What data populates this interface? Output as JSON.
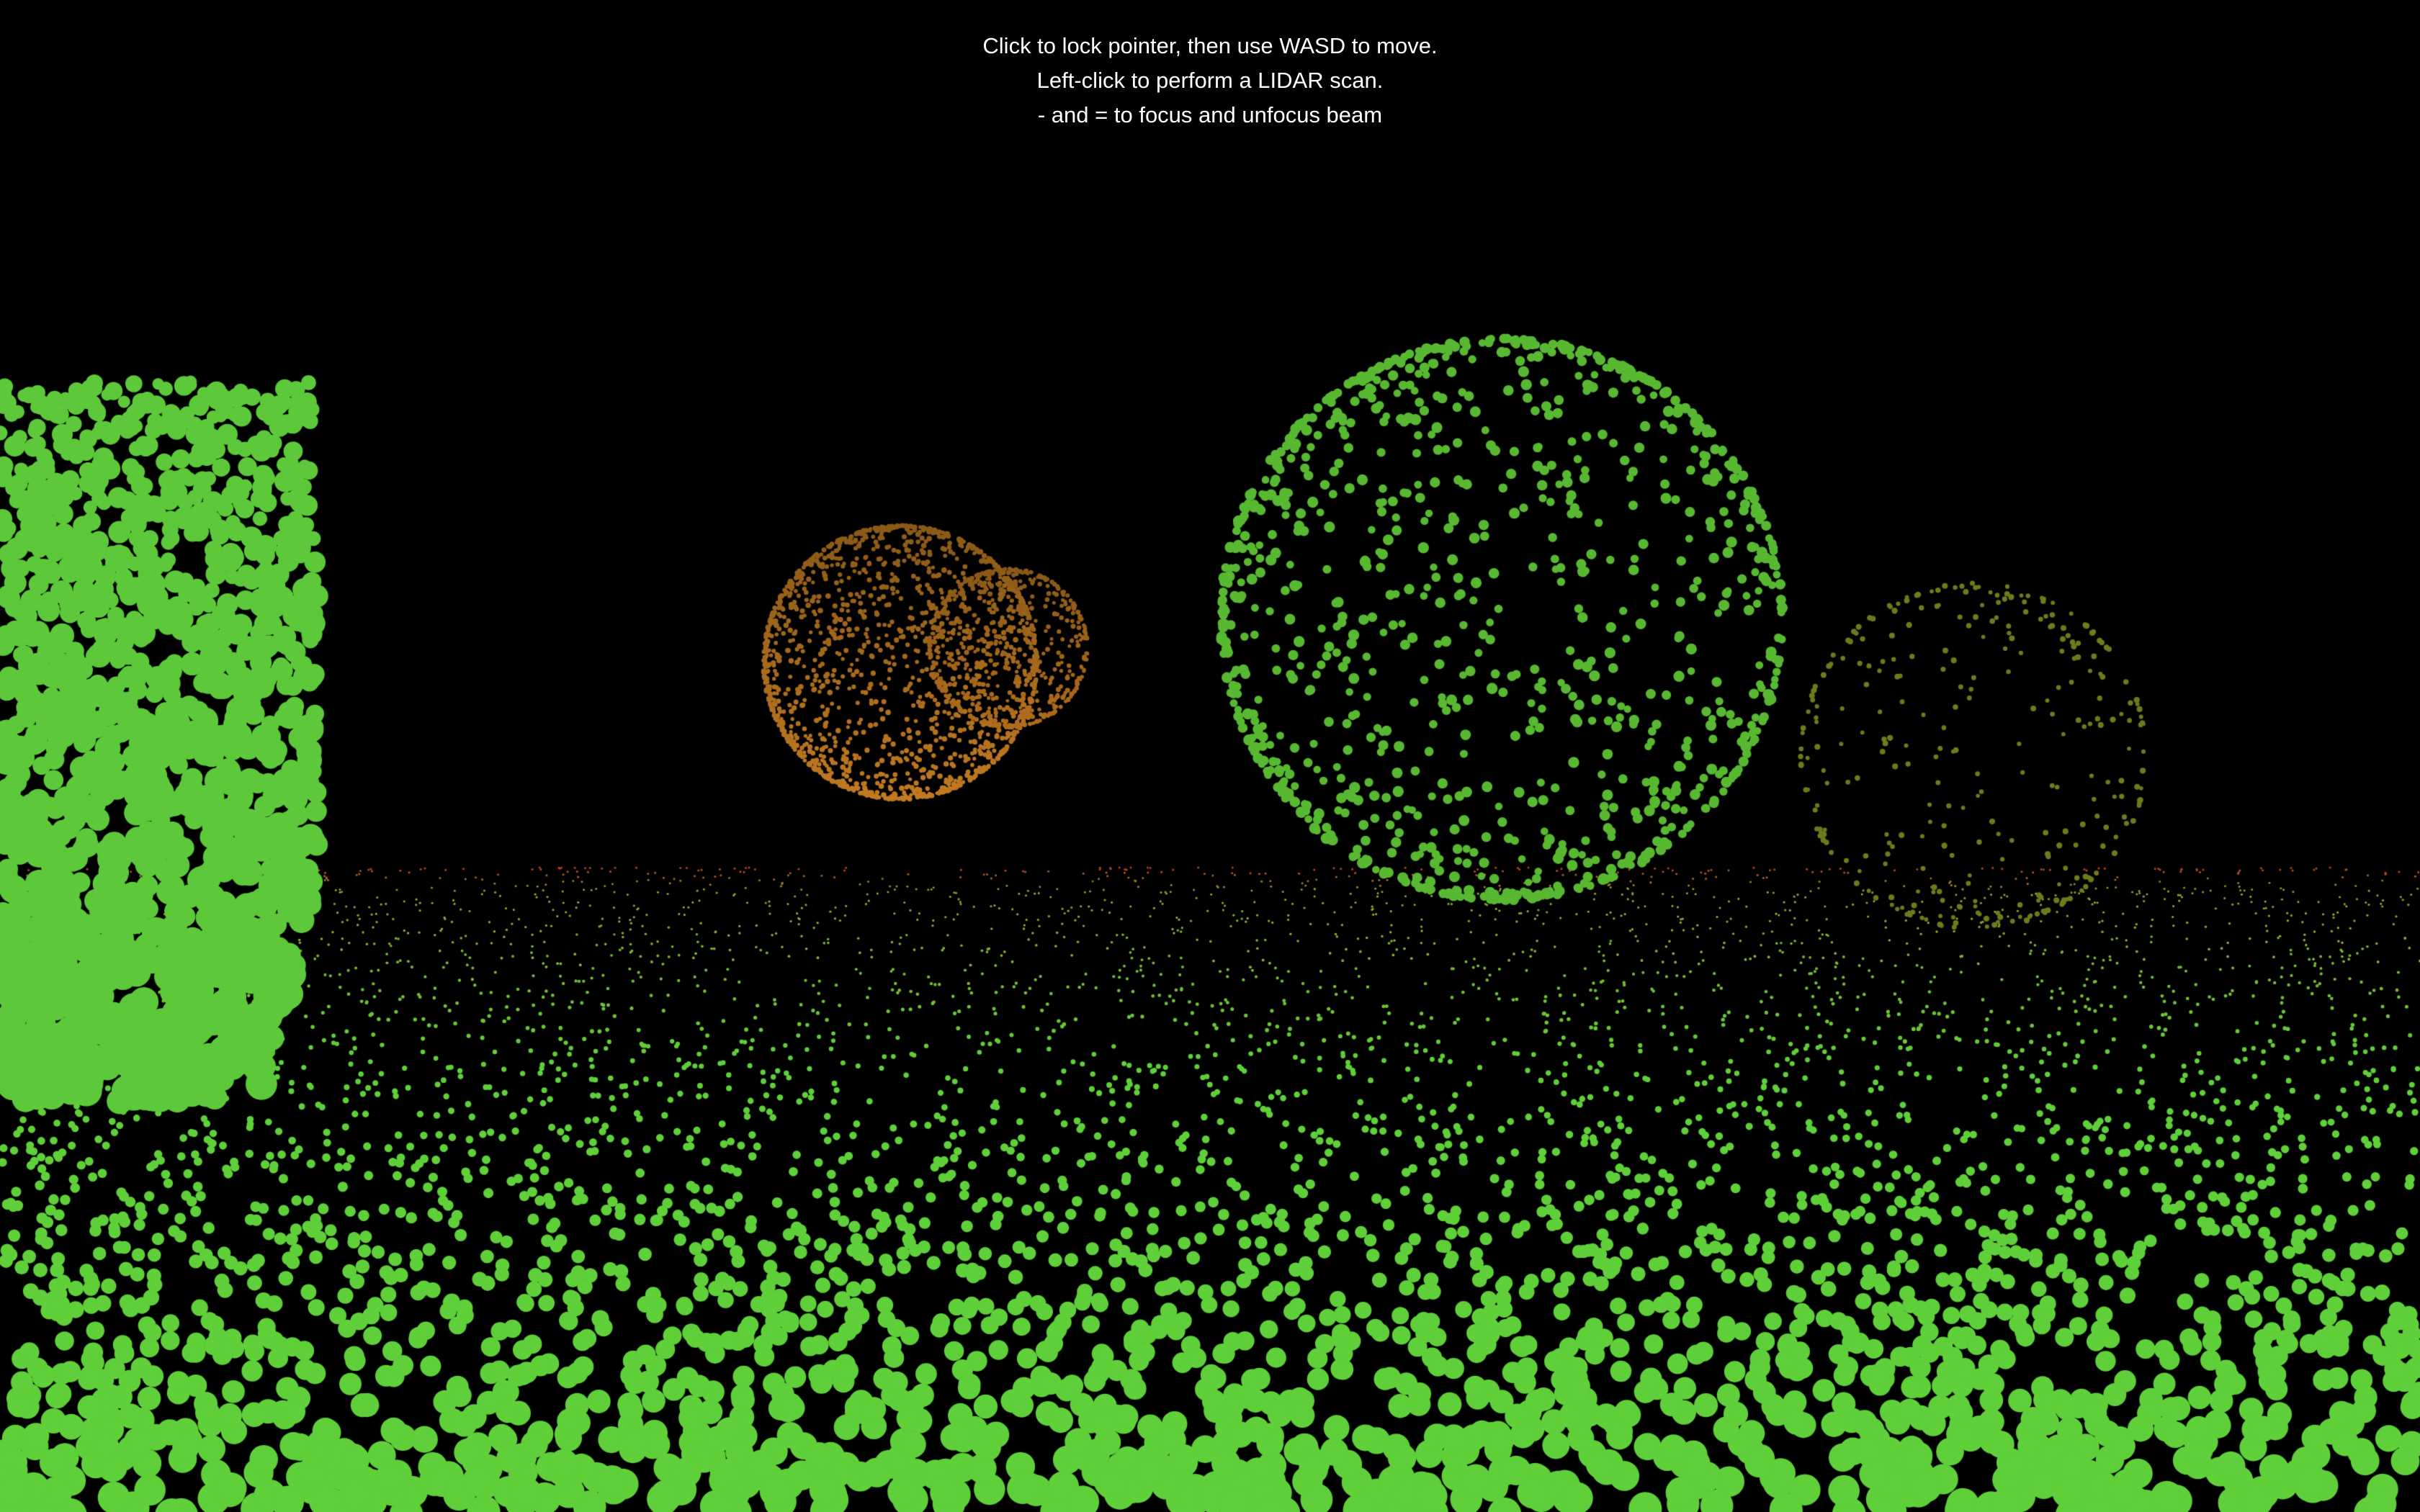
{
  "instructions": {
    "line1": "Click to lock pointer, then use WASD to move.",
    "line2": "Left-click to perform a LIDAR scan.",
    "line3": "- and = to focus and unfocus beam"
  },
  "scene": {
    "background": "#000000",
    "point_colors": {
      "near": "#5fcf3a",
      "mid": "#8aa828",
      "far": "#c0401a",
      "orange_object": "#b8741e"
    }
  }
}
